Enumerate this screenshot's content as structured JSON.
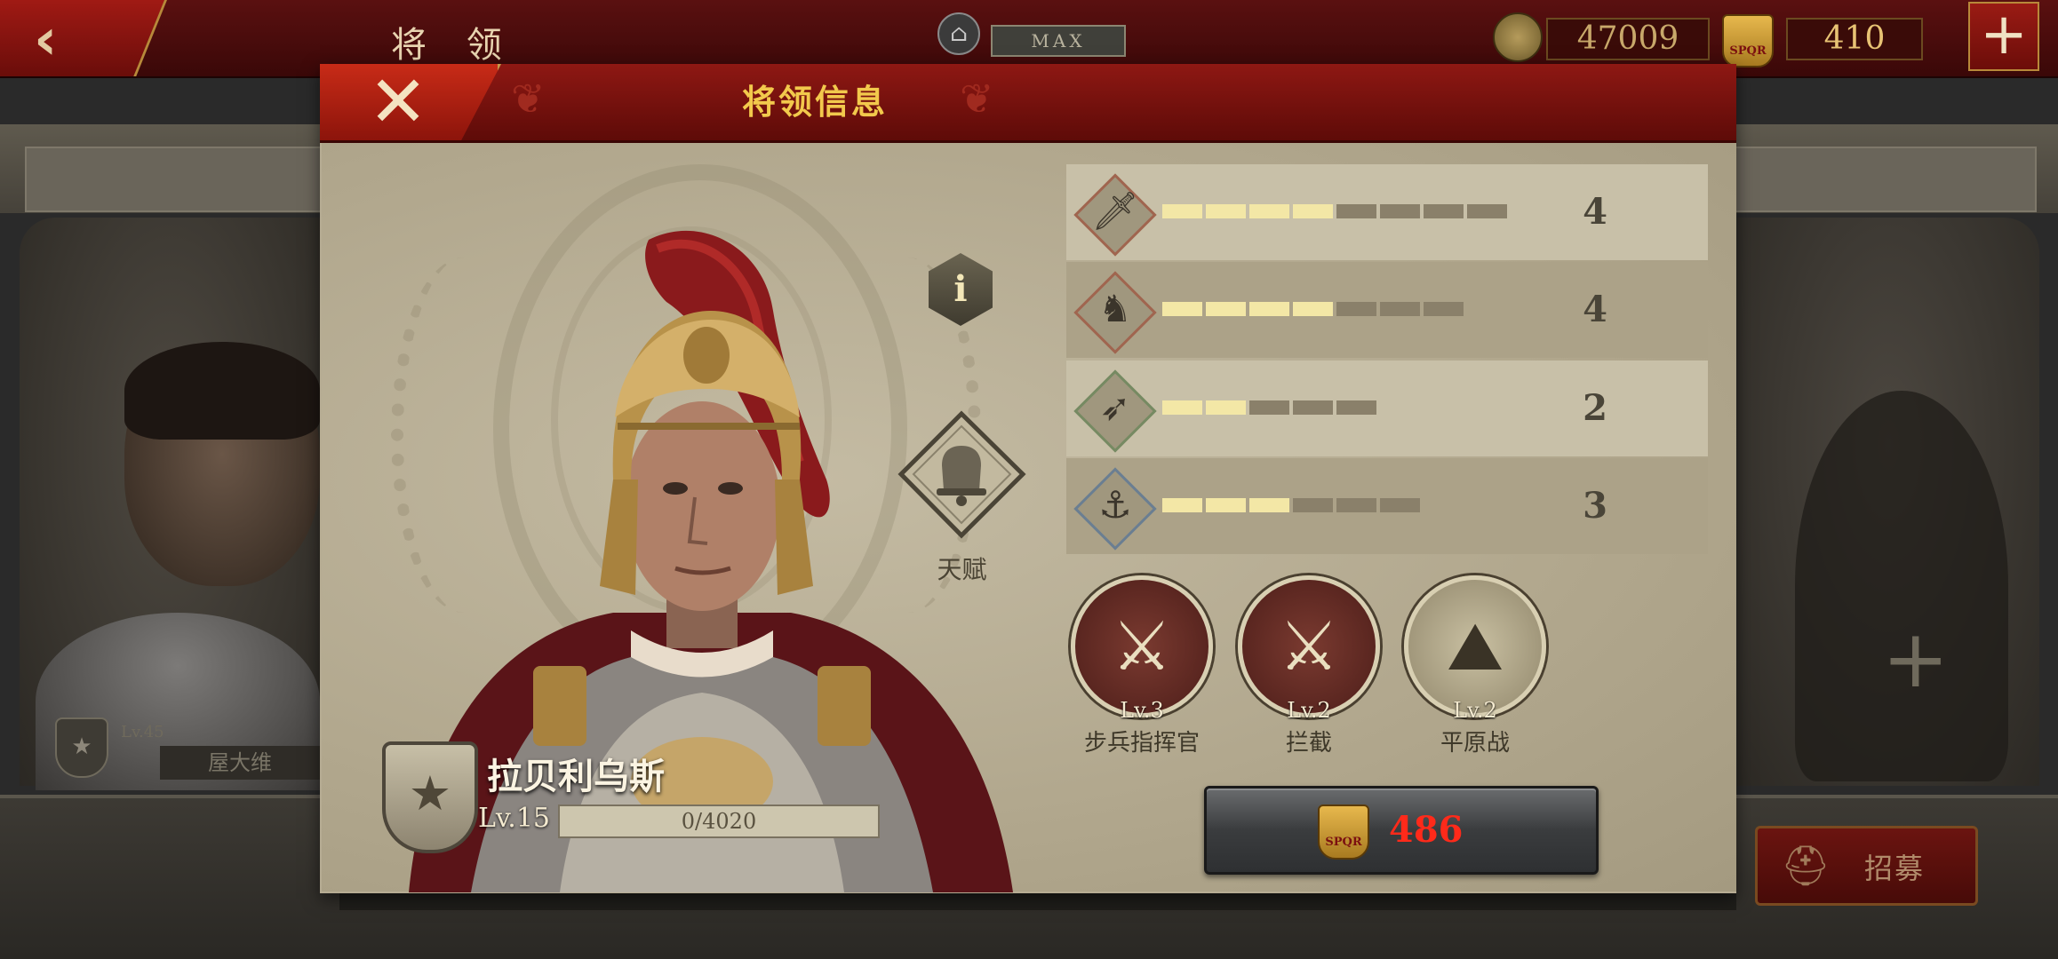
{
  "background": {
    "back_glyph": "‹",
    "screen_title": "将 领",
    "temple_icon": "temple-icon",
    "max_label": "MAX",
    "coin_amount": "47009",
    "spqr_amount": "410",
    "spqr_text": "SPQR",
    "plus_glyph": "+",
    "left_card": {
      "level": "Lv.45",
      "name": "屋大维",
      "badge_glyph": "★"
    },
    "right_card": {
      "add_glyph": "+"
    },
    "recruit_label": "招募",
    "recruit_icon": "helmet-plus-icon"
  },
  "modal": {
    "title": "将领信息",
    "close_glyph": "✕",
    "info_glyph": "i",
    "talent_label": "天赋",
    "stats": [
      {
        "name": "infantry",
        "icon": "sword-icon",
        "glyph": "🗡",
        "value": "4",
        "filled": 4,
        "total": 8
      },
      {
        "name": "cavalry",
        "icon": "horse-icon",
        "glyph": "♞",
        "value": "4",
        "filled": 4,
        "total": 7
      },
      {
        "name": "archery",
        "icon": "bow-icon",
        "glyph": "➶",
        "value": "2",
        "filled": 2,
        "total": 5
      },
      {
        "name": "navy",
        "icon": "anchor-icon",
        "glyph": "⚓",
        "value": "3",
        "filled": 3,
        "total": 6
      }
    ],
    "skills": [
      {
        "icon": "crossed-swords-icon",
        "glyph": "⚔",
        "level": "Lv.3",
        "name": "步兵指挥官"
      },
      {
        "icon": "soldier-attack-icon",
        "glyph": "⚔",
        "level": "Lv.2",
        "name": "拦截"
      },
      {
        "icon": "plain-field-icon",
        "glyph": "⛰",
        "level": "Lv.2",
        "name": "平原战"
      }
    ],
    "general": {
      "name": "拉贝利乌斯",
      "level": "Lv.15",
      "xp_text": "0/4020",
      "xp_fraction": 0
    },
    "cost": {
      "icon": "spqr-coin-icon",
      "text": "SPQR",
      "value": "486"
    }
  },
  "colors": {
    "header_red": "#8e1813",
    "title_gold": "#f2c94c",
    "cost_red": "#ff2a1a",
    "bar_on": "#f3e7a6",
    "bar_off": "#8a806a"
  }
}
